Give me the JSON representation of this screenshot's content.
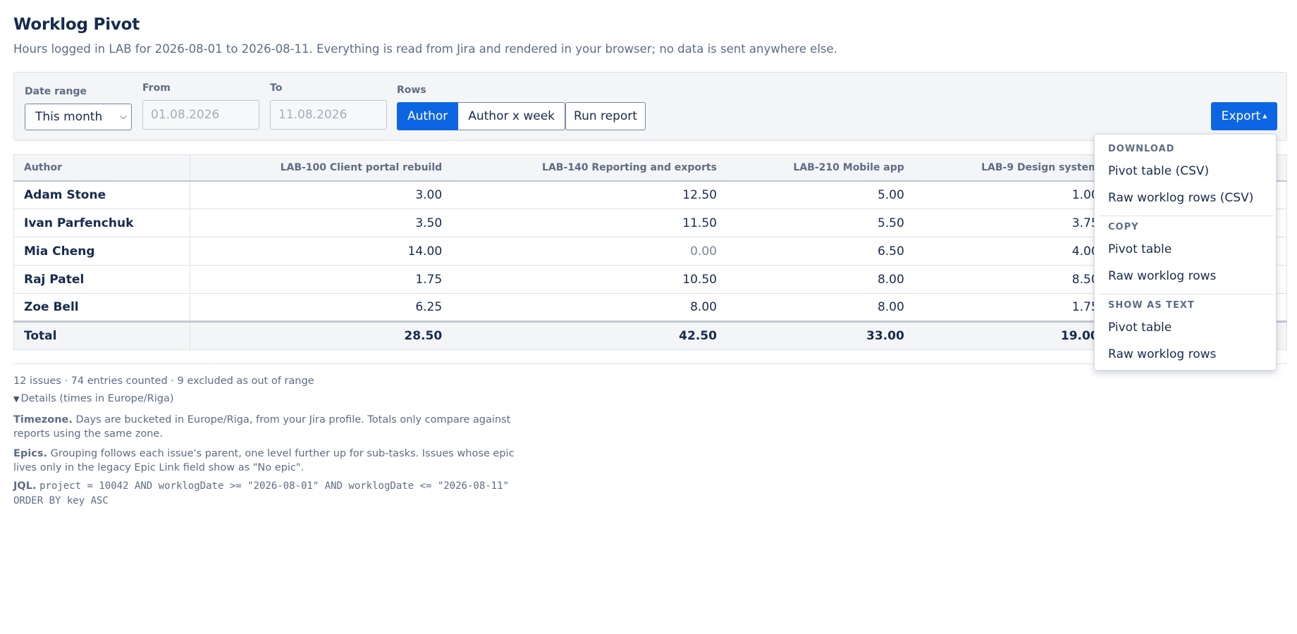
{
  "page": {
    "title": "Worklog Pivot",
    "subtitle": "Hours logged in LAB for 2026-08-01 to 2026-08-11. Everything is read from Jira and rendered in your browser; no data is sent anywhere else."
  },
  "toolbar": {
    "date_range_label": "Date range",
    "date_range_value": "This month",
    "from_label": "From",
    "from_placeholder": "01.08.2026",
    "to_label": "To",
    "to_placeholder": "11.08.2026",
    "rows_label": "Rows",
    "rows_options": [
      "Author",
      "Author x week"
    ],
    "rows_selected": "Author",
    "run_label": "Run report",
    "export_label": "Export",
    "accent_color": "#0c66e4"
  },
  "table": {
    "headers": [
      "Author",
      "LAB-100 Client portal rebuild",
      "LAB-140 Reporting and exports",
      "LAB-210 Mobile app",
      "LAB-9 Design system"
    ],
    "rows": [
      {
        "author": "Adam Stone",
        "values": [
          "3.00",
          "12.50",
          "5.00",
          "1.00"
        ]
      },
      {
        "author": "Ivan Parfenchuk",
        "values": [
          "3.50",
          "11.50",
          "5.50",
          "3.75"
        ]
      },
      {
        "author": "Mia Cheng",
        "values": [
          "14.00",
          "0.00",
          "6.50",
          "4.00"
        ]
      },
      {
        "author": "Raj Patel",
        "values": [
          "1.75",
          "10.50",
          "8.00",
          "8.50"
        ]
      },
      {
        "author": "Zoe Bell",
        "values": [
          "6.25",
          "8.00",
          "8.00",
          "1.75"
        ]
      }
    ],
    "total": {
      "label": "Total",
      "values": [
        "28.50",
        "42.50",
        "33.00",
        "19.00"
      ]
    }
  },
  "footer": {
    "summary": "12 issues · 74 entries counted · 9 excluded as out of range",
    "details_label": "Details (times in Europe/Riga)",
    "timezone_title": "Timezone.",
    "timezone_text": "Days are bucketed in Europe/Riga, from your Jira profile. Totals only compare against reports using the same zone.",
    "epics_title": "Epics.",
    "epics_text": "Grouping follows each issue's parent, one level further up for sub-tasks. Issues whose epic lives only in the legacy Epic Link field show as \"No epic\".",
    "jql_title": "JQL.",
    "jql_text": "project = 10042 AND worklogDate >= \"2026-08-01\" AND worklogDate <= \"2026-08-11\" ORDER BY key ASC"
  },
  "export_menu": {
    "sections": [
      {
        "title": "DOWNLOAD",
        "items": [
          "Pivot table (CSV)",
          "Raw worklog rows (CSV)"
        ]
      },
      {
        "title": "COPY",
        "items": [
          "Pivot table",
          "Raw worklog rows"
        ]
      },
      {
        "title": "SHOW AS TEXT",
        "items": [
          "Pivot table",
          "Raw worklog rows"
        ]
      }
    ]
  }
}
